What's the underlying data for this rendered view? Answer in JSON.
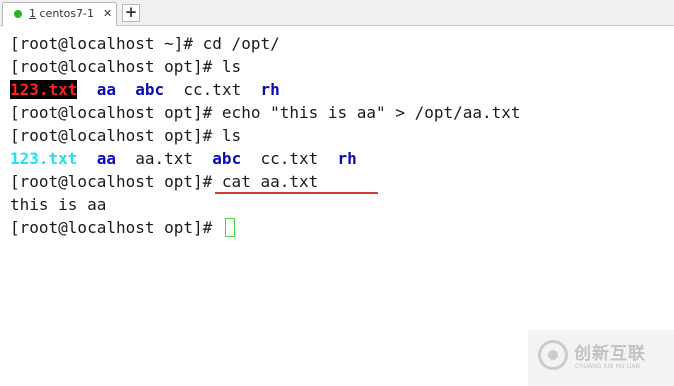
{
  "tab": {
    "index": "1",
    "title": "centos7-1",
    "close": "✕",
    "new_tab": "+"
  },
  "terminal": {
    "lines": [
      {
        "prompt": "[root@localhost ~]# ",
        "command": "cd /opt/"
      },
      {
        "prompt": "[root@localhost opt]# ",
        "command": "ls"
      },
      {
        "files": [
          "123.txt",
          "aa",
          "abc",
          "cc.txt",
          "rh"
        ]
      },
      {
        "prompt": "[root@localhost opt]# ",
        "command": "echo \"this is aa\" > /opt/aa.txt"
      },
      {
        "prompt": "[root@localhost opt]# ",
        "command": "ls"
      },
      {
        "files": [
          "123.txt",
          "aa",
          "aa.txt",
          "abc",
          "cc.txt",
          "rh"
        ]
      },
      {
        "prompt": "[root@localhost opt]# ",
        "command": "cat aa.txt"
      },
      {
        "output": "this is aa"
      },
      {
        "prompt": "[root@localhost opt]# ",
        "command": ""
      }
    ]
  },
  "colors": {
    "directory": "#0a0ab8",
    "red_file": "#ff2020",
    "cyan_file": "#22e0f0",
    "cursor": "#3ddc3d",
    "annotation_underline": "#d23b3b"
  },
  "watermark": {
    "title": "创新互联",
    "subtitle": "CHUANG XIN HU LIAN"
  }
}
